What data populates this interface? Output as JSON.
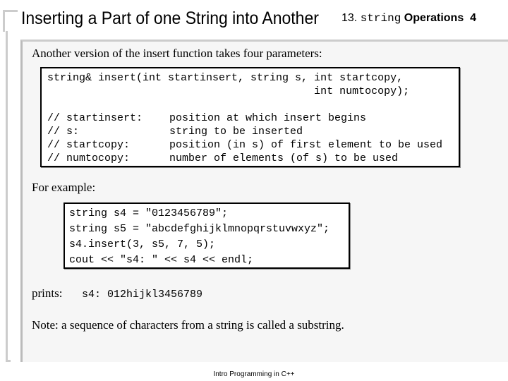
{
  "header": {
    "title": "Inserting a Part of one String into Another",
    "section_number": "13.",
    "section_code": "string",
    "section_word": "Operations",
    "page_number": "4"
  },
  "intro": "Another version of the insert function takes four parameters:",
  "signature": [
    "string& insert(int startinsert, string s, int startcopy,",
    "                                          int numtocopy);"
  ],
  "params": [
    {
      "name": "// startinsert:",
      "desc": "position at which insert begins"
    },
    {
      "name": "// s:",
      "desc": "string to be inserted"
    },
    {
      "name": "// startcopy:",
      "desc": "position (in s) of first element to be used"
    },
    {
      "name": "// numtocopy:",
      "desc": "number of elements (of s) to be used"
    }
  ],
  "example_label": "For example:",
  "example_code": [
    "string s4 = \"0123456789\";",
    "string s5 = \"abcdefghijklmnopqrstuvwxyz\";",
    "s4.insert(3, s5, 7, 5);",
    "cout << \"s4: \" << s4 << endl;"
  ],
  "prints_label": "prints:",
  "prints_output": "s4: 012hijkl3456789",
  "note": "Note:  a sequence of characters from a string is called a substring.",
  "footer": "Intro Programming in C++"
}
